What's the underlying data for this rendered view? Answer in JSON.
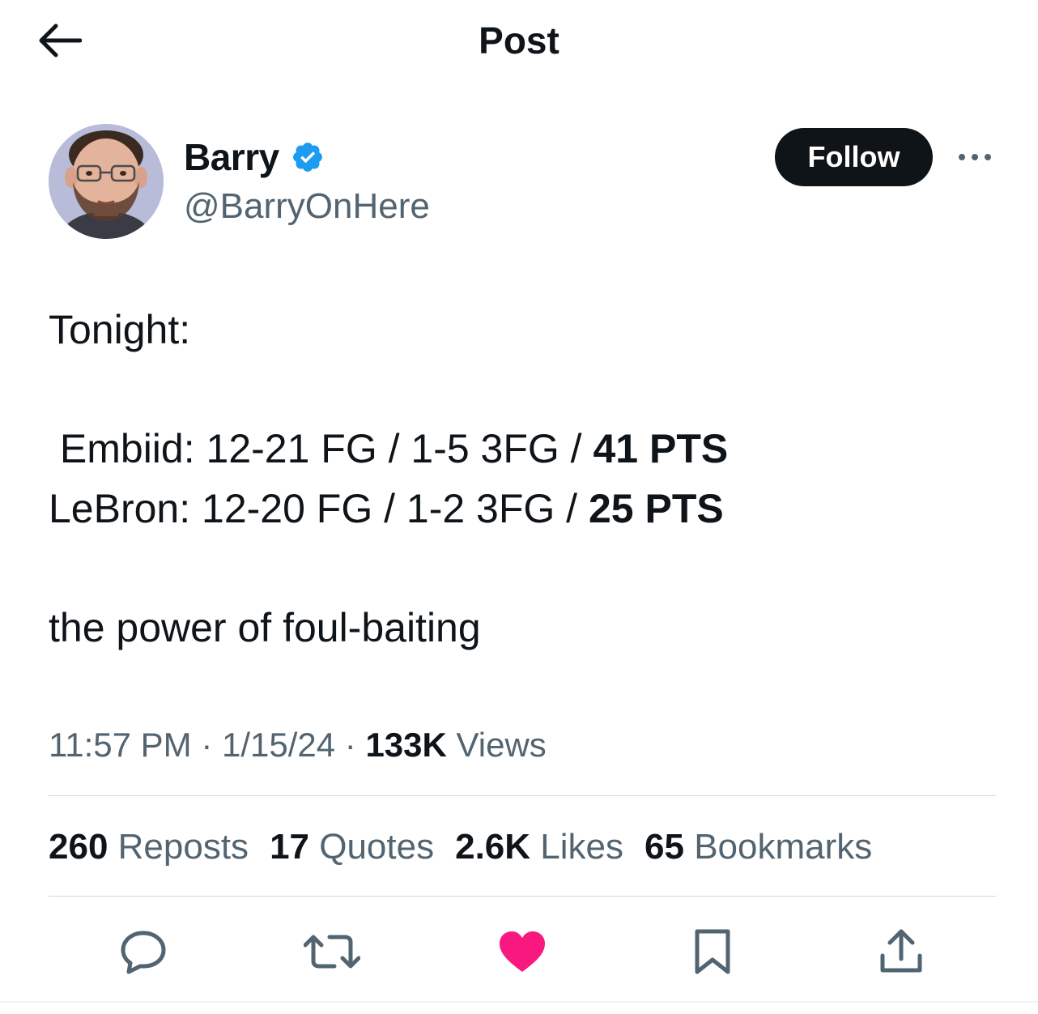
{
  "header": {
    "title": "Post",
    "back_icon": "arrow-left-icon"
  },
  "author": {
    "name": "Barry",
    "handle": "@BarryOnHere",
    "verified": true,
    "verified_color": "#1d9bf0",
    "follow_label": "Follow"
  },
  "tweet": {
    "line1": "Tonight:",
    "line2_prefix": " Embiid: 12-21 FG / 1-5 3FG / ",
    "line2_bold": "41 PTS",
    "line3_prefix": "LeBron: 12-20 FG / 1-2 3FG / ",
    "line3_bold": "25 PTS",
    "line4": "the power of foul-baiting"
  },
  "meta": {
    "time": "11:57 PM",
    "separator": " · ",
    "date": "1/15/24",
    "views_count": "133K",
    "views_label": " Views"
  },
  "stats": {
    "reposts_count": "260",
    "reposts_label": " Reposts",
    "quotes_count": "17",
    "quotes_label": " Quotes",
    "likes_count": "2.6K",
    "likes_label": " Likes",
    "bookmarks_count": "65",
    "bookmarks_label": " Bookmarks"
  },
  "actions": {
    "reply_icon": "reply-icon",
    "repost_icon": "repost-icon",
    "like_icon": "heart-icon",
    "like_color": "#f91880",
    "bookmark_icon": "bookmark-icon",
    "share_icon": "share-icon"
  }
}
